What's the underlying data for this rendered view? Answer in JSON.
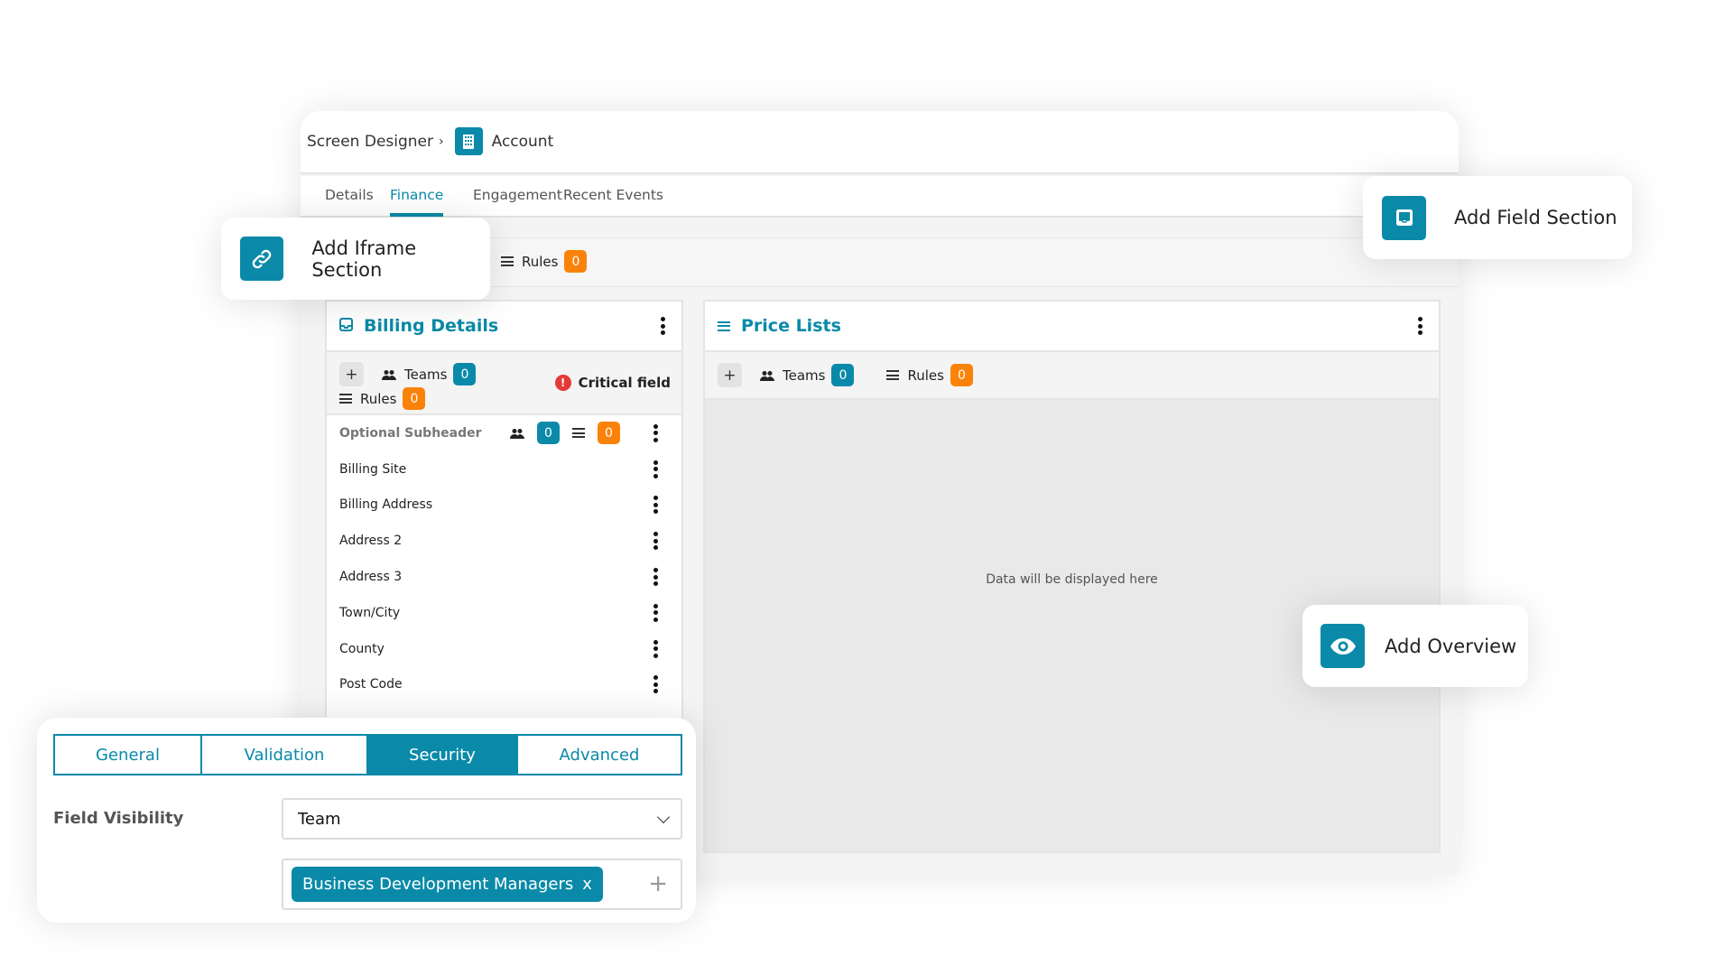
{
  "breadcrumb": {
    "parent": "Screen Designer",
    "current": "Account"
  },
  "tabs": [
    {
      "label": "Details",
      "active": false
    },
    {
      "label": "Finance",
      "active": true
    },
    {
      "label": "Engagement",
      "active": false
    },
    {
      "label": "Recent Events",
      "active": false
    }
  ],
  "toolbar": {
    "rules_label": "Rules",
    "rules_count": "0"
  },
  "billing": {
    "title": "Billing Details",
    "teams_label": "Teams",
    "teams_count": "0",
    "rules_label": "Rules",
    "rules_count": "0",
    "critical_label": "Critical field",
    "subheader": {
      "label": "Optional Subheader",
      "teams_count": "0",
      "rules_count": "0"
    },
    "fields": [
      "Billing Site",
      "Billing Address",
      "Address 2",
      "Address 3",
      "Town/City",
      "County",
      "Post Code"
    ]
  },
  "price_lists": {
    "title": "Price Lists",
    "teams_label": "Teams",
    "teams_count": "0",
    "rules_label": "Rules",
    "rules_count": "0",
    "placeholder": "Data will be displayed here"
  },
  "popups": {
    "iframe": "Add Iframe Section",
    "field_section": "Add Field Section",
    "overview": "Add Overview"
  },
  "panel": {
    "tabs": [
      {
        "label": "General",
        "active": false
      },
      {
        "label": "Validation",
        "active": false
      },
      {
        "label": "Security",
        "active": true
      },
      {
        "label": "Advanced",
        "active": false
      }
    ],
    "field_visibility_label": "Field Visibility",
    "field_visibility_value": "Team",
    "selected_team": "Business Development Managers",
    "remove_glyph": "x",
    "add_glyph": "+"
  },
  "colors": {
    "accent": "#0a8aa8",
    "orange": "#fb8209",
    "critical": "#e53935"
  }
}
